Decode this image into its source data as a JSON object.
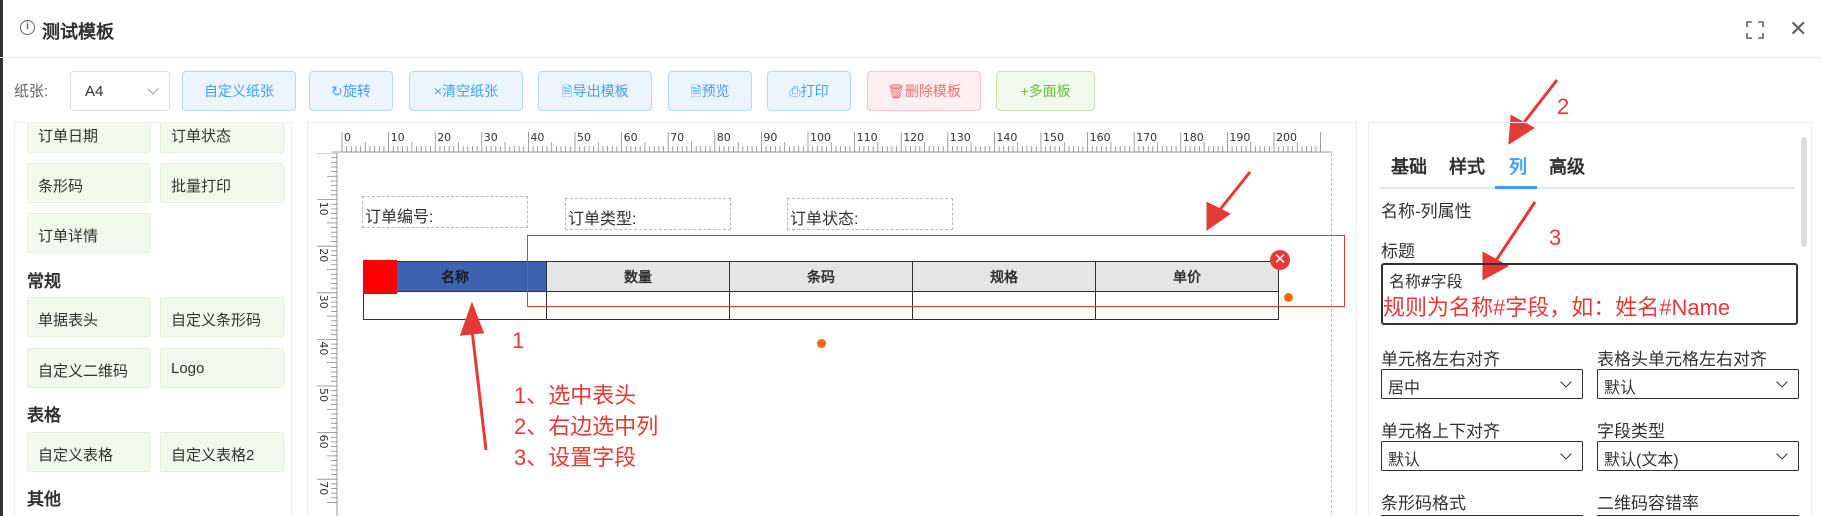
{
  "dialog": {
    "title": "测试模板",
    "title_icon": "info-circle-icon",
    "fullscreen_icon": "fullscreen-icon",
    "close_glyph": "✕"
  },
  "toolbar": {
    "paper_label": "纸张:",
    "paper_value": "A4",
    "buttons": [
      {
        "id": "custom-paper",
        "label": "自定义纸张"
      },
      {
        "id": "rotate",
        "label": "↻旋转"
      },
      {
        "id": "clear-paper",
        "label": "×清空纸张"
      },
      {
        "id": "export-template",
        "label": "🗎导出模板"
      },
      {
        "id": "preview",
        "label": "🗎预览"
      },
      {
        "id": "print",
        "label": "⎙打印"
      },
      {
        "id": "delete-template",
        "label": "🗑删除模板"
      },
      {
        "id": "multi-panel",
        "label": "+多面板"
      }
    ]
  },
  "palette": {
    "items_top": [
      "订单日期",
      "订单状态",
      "条形码",
      "批量打印",
      "订单详情"
    ],
    "groups": [
      {
        "title": "常规",
        "items": [
          "单据表头",
          "自定义条形码",
          "自定义二维码",
          "Logo"
        ]
      },
      {
        "title": "表格",
        "items": [
          "自定义表格",
          "自定义表格2"
        ]
      },
      {
        "title": "其他",
        "items": []
      }
    ]
  },
  "canvas": {
    "ruler_top_labels": [
      "0",
      "10",
      "20",
      "30",
      "40",
      "50",
      "60",
      "70",
      "80",
      "90",
      "100",
      "110",
      "120",
      "130",
      "140",
      "150",
      "160",
      "170",
      "180",
      "190",
      "200"
    ],
    "ruler_left_labels": [
      "10",
      "20",
      "30",
      "40",
      "50",
      "60",
      "70"
    ],
    "fields": [
      "订单编号:",
      "订单类型:",
      "订单状态:"
    ],
    "table_headers": [
      "名称",
      "数量",
      "条码",
      "规格",
      "单价"
    ],
    "delete_glyph": "✕"
  },
  "annotations": {
    "num1": "1",
    "num2": "2",
    "num3": "3",
    "steps": [
      "1、选中表头",
      "2、右边选中列",
      "3、设置字段"
    ],
    "rule": "规则为名称#字段，如：姓名#Name",
    "color": "#e53935"
  },
  "panel": {
    "tabs": [
      "基础",
      "样式",
      "列",
      "高级"
    ],
    "active_tab": "列",
    "section_title": "名称-列属性",
    "title_label": "标题",
    "title_value": "名称#字段",
    "fields": [
      {
        "label": "单元格左右对齐",
        "value": "居中"
      },
      {
        "label": "表格头单元格左右对齐",
        "value": "默认"
      },
      {
        "label": "单元格上下对齐",
        "value": "默认"
      },
      {
        "label": "字段类型",
        "value": "默认(文本)"
      },
      {
        "label": "条形码格式",
        "value": ""
      },
      {
        "label": "二维码容错率",
        "value": ""
      }
    ]
  },
  "colors": {
    "primary": "#409eff",
    "danger": "#f56c6c",
    "success": "#67c23a",
    "selected_header": "#3d63b0"
  }
}
